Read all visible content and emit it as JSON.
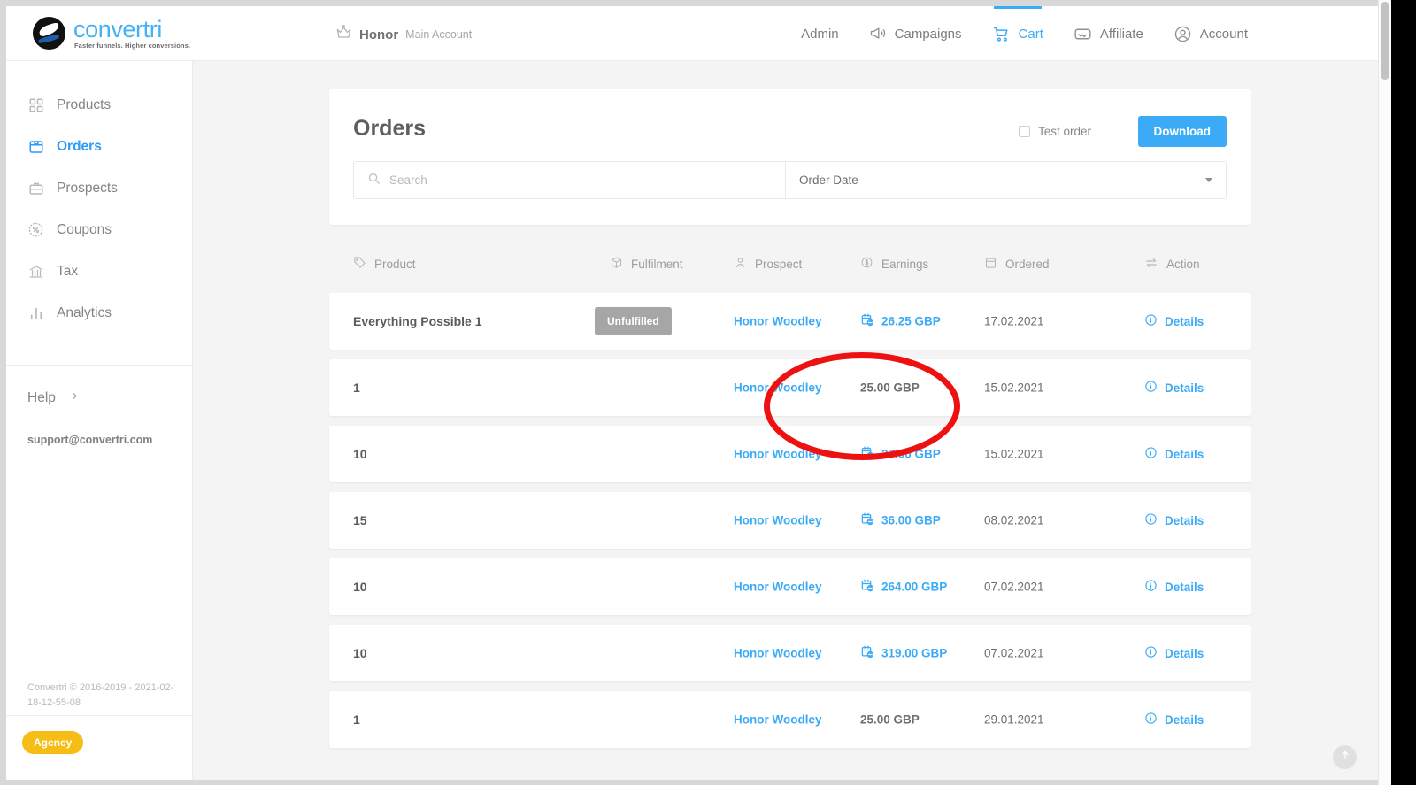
{
  "header": {
    "logo_word": "convertri",
    "logo_tagline": "Faster funnels. Higher conversions.",
    "account_name": "Honor",
    "account_subtitle": "Main Account",
    "nav": [
      {
        "label": "Admin",
        "icon": "",
        "active": false
      },
      {
        "label": "Campaigns",
        "icon": "megaphone-icon",
        "active": false
      },
      {
        "label": "Cart",
        "icon": "cart-icon",
        "active": true
      },
      {
        "label": "Affiliate",
        "icon": "handshake-icon",
        "active": false
      },
      {
        "label": "Account",
        "icon": "user-circle-icon",
        "active": false
      }
    ]
  },
  "sidebar": {
    "items": [
      {
        "label": "Products",
        "icon": "grid-icon",
        "active": false
      },
      {
        "label": "Orders",
        "icon": "box-icon",
        "active": true
      },
      {
        "label": "Prospects",
        "icon": "briefcase-icon",
        "active": false
      },
      {
        "label": "Coupons",
        "icon": "percent-badge-icon",
        "active": false
      },
      {
        "label": "Tax",
        "icon": "bank-icon",
        "active": false
      },
      {
        "label": "Analytics",
        "icon": "bar-chart-icon",
        "active": false
      }
    ],
    "help_label": "Help",
    "support_email": "support@convertri.com",
    "copyright": "Convertri © 2016-2019 - 2021-02-18-12-55-08",
    "agency_badge": "Agency"
  },
  "orders": {
    "title": "Orders",
    "test_order_label": "Test order",
    "test_order_checked": false,
    "download_label": "Download",
    "search_placeholder": "Search",
    "search_value": "",
    "sort_selected": "Order Date",
    "columns": [
      {
        "label": "Product",
        "icon": "tag-icon"
      },
      {
        "label": "Fulfilment",
        "icon": "package-icon"
      },
      {
        "label": "Prospect",
        "icon": "person-icon"
      },
      {
        "label": "Earnings",
        "icon": "dollar-circle-icon"
      },
      {
        "label": "Ordered",
        "icon": "calendar-icon"
      },
      {
        "label": "Action",
        "icon": "transfer-icon"
      }
    ],
    "action_label": "Details",
    "rows": [
      {
        "product": "Everything Possible 1",
        "fulfilment": "Unfulfilled",
        "prospect": "Honor Woodley",
        "earnings": "26.25 GBP",
        "recurring": true,
        "ordered": "17.02.2021"
      },
      {
        "product": "1",
        "fulfilment": "",
        "prospect": "Honor Woodley",
        "earnings": "25.00 GBP",
        "recurring": false,
        "ordered": "15.02.2021"
      },
      {
        "product": "10",
        "fulfilment": "",
        "prospect": "Honor Woodley",
        "earnings": "27.00 GBP",
        "recurring": true,
        "ordered": "15.02.2021"
      },
      {
        "product": "15",
        "fulfilment": "",
        "prospect": "Honor Woodley",
        "earnings": "36.00 GBP",
        "recurring": true,
        "ordered": "08.02.2021"
      },
      {
        "product": "10",
        "fulfilment": "",
        "prospect": "Honor Woodley",
        "earnings": "264.00 GBP",
        "recurring": true,
        "ordered": "07.02.2021"
      },
      {
        "product": "10",
        "fulfilment": "",
        "prospect": "Honor Woodley",
        "earnings": "319.00 GBP",
        "recurring": true,
        "ordered": "07.02.2021"
      },
      {
        "product": "1",
        "fulfilment": "",
        "prospect": "Honor Woodley",
        "earnings": "25.00 GBP",
        "recurring": false,
        "ordered": "29.01.2021"
      }
    ]
  },
  "annotation": {
    "shape": "ellipse",
    "color": "#ee1111",
    "target": "Unfulfilled badge"
  },
  "colors": {
    "accent": "#3babf7",
    "badge_gray": "#a6a6a6",
    "agency_yellow": "#f6bd16",
    "page_bg": "#f4f4f5"
  },
  "scroll_to_top_icon": "arrow-up-icon"
}
